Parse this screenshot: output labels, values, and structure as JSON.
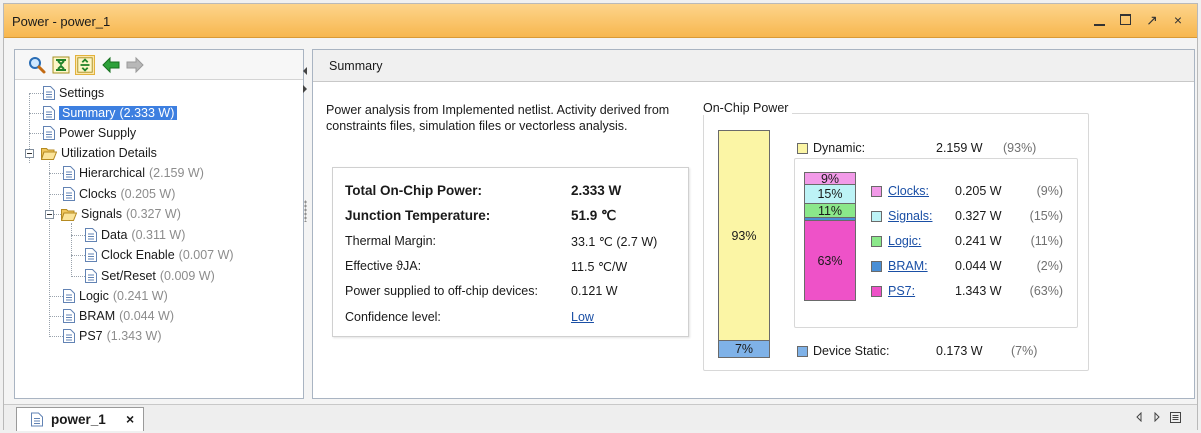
{
  "window": {
    "title": "Power - power_1",
    "restore_glyph": "↗",
    "close_glyph": "×"
  },
  "toolbar": {
    "icons": [
      "search-icon",
      "collapse-all-icon",
      "expand-all-icon",
      "back-arrow-icon",
      "forward-arrow-icon"
    ]
  },
  "tree": {
    "settings": {
      "label": "Settings"
    },
    "summary": {
      "label": "Summary",
      "value": "(2.333 W)"
    },
    "power_supply": {
      "label": "Power Supply"
    },
    "utilization": {
      "label": "Utilization Details"
    },
    "hierarchical": {
      "label": "Hierarchical",
      "value": "(2.159 W)"
    },
    "clocks": {
      "label": "Clocks",
      "value": "(0.205 W)"
    },
    "signals": {
      "label": "Signals",
      "value": "(0.327 W)"
    },
    "data": {
      "label": "Data",
      "value": "(0.311 W)"
    },
    "clock_enable": {
      "label": "Clock Enable",
      "value": "(0.007 W)"
    },
    "set_reset": {
      "label": "Set/Reset",
      "value": "(0.009 W)"
    },
    "logic": {
      "label": "Logic",
      "value": "(0.241 W)"
    },
    "bram": {
      "label": "BRAM",
      "value": "(0.044 W)"
    },
    "ps7": {
      "label": "PS7",
      "value": "(1.343 W)"
    }
  },
  "summary_panel": {
    "header": "Summary",
    "description": "Power analysis from Implemented netlist. Activity derived from constraints files, simulation files or vectorless analysis.",
    "rows": [
      {
        "key": "Total On-Chip Power:",
        "value": "2.333 W"
      },
      {
        "key": "Junction Temperature:",
        "value": "51.9 ℃"
      },
      {
        "key": "Thermal Margin:",
        "value": "33.1 ℃ (2.7 W)"
      },
      {
        "key": "Effective ϑJA:",
        "value": "11.5 ℃/W"
      },
      {
        "key": "Power supplied to off-chip devices:",
        "value": "0.121 W"
      },
      {
        "key": "Confidence level:",
        "value": "Low"
      }
    ]
  },
  "on_chip_power": {
    "title": "On-Chip Power",
    "dynamic": {
      "label": "Dynamic:",
      "value": "2.159 W",
      "pct": "(93%)",
      "color": "#fbf5a5"
    },
    "device_static": {
      "label": "Device Static:",
      "value": "0.173 W",
      "pct": "(7%)",
      "color": "#7fb2e8"
    },
    "big_bar": [
      {
        "label": "93%",
        "fraction": 0.925,
        "color": "#fbf5a5"
      },
      {
        "label": "7%",
        "fraction": 0.075,
        "color": "#7fb2e8"
      }
    ],
    "breakdown": [
      {
        "label": "Clocks:",
        "value": "0.205 W",
        "pct": "(9%)",
        "bar_label": "9%",
        "fraction": 0.088,
        "color": "#f29ae8"
      },
      {
        "label": "Signals:",
        "value": "0.327 W",
        "pct": "(15%)",
        "bar_label": "15%",
        "fraction": 0.151,
        "color": "#bdf3f6"
      },
      {
        "label": "Logic:",
        "value": "0.241 W",
        "pct": "(11%)",
        "bar_label": "11%",
        "fraction": 0.112,
        "color": "#8be88a"
      },
      {
        "label": "BRAM:",
        "value": "0.044 W",
        "pct": "(2%)",
        "bar_label": "",
        "fraction": 0.02,
        "color": "#4a8fd6"
      },
      {
        "label": "PS7:",
        "value": "1.343 W",
        "pct": "(63%)",
        "bar_label": "63%",
        "fraction": 0.629,
        "color": "#ee52c8"
      }
    ]
  },
  "bottom_tab": {
    "label": "power_1",
    "close": "×"
  },
  "colors": {
    "title_bar": "#f7b74f",
    "selection": "#3d7fe0",
    "link": "#1a4fa5"
  }
}
